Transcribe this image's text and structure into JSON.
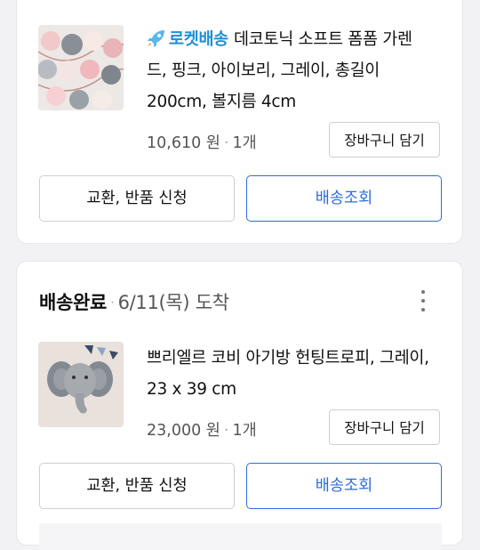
{
  "orders": [
    {
      "product": {
        "badge": "로켓배송",
        "badge_icon": "rocket-icon",
        "title_line1": "데코토닉 소프트 폼폼 가렌",
        "title_line2": "드, 핑크, 아이보리, 그레이, 총길이",
        "title_line3": "200cm, 볼지름 4cm",
        "price": "10,610 원",
        "quantity": "1개",
        "cart_button": "장바구니 담기"
      },
      "actions": {
        "return_button": "교환, 반품 신청",
        "track_button": "배송조회"
      }
    },
    {
      "status": {
        "label": "배송완료",
        "date": "6/11(목) 도착",
        "more_icon": "more-vertical-icon"
      },
      "product": {
        "title_line1": "쁘리엘르 코비 아기방 헌팅트로피, 그레이,",
        "title_line2": "23 x 39 cm",
        "price": "23,000 원",
        "quantity": "1개",
        "cart_button": "장바구니 담기"
      },
      "actions": {
        "return_button": "교환, 반품 신청",
        "track_button": "배송조회"
      }
    }
  ],
  "colors": {
    "accent_blue": "#2b6cde",
    "rocket_blue": "#1e8fd6",
    "background": "#f2f2f5"
  }
}
